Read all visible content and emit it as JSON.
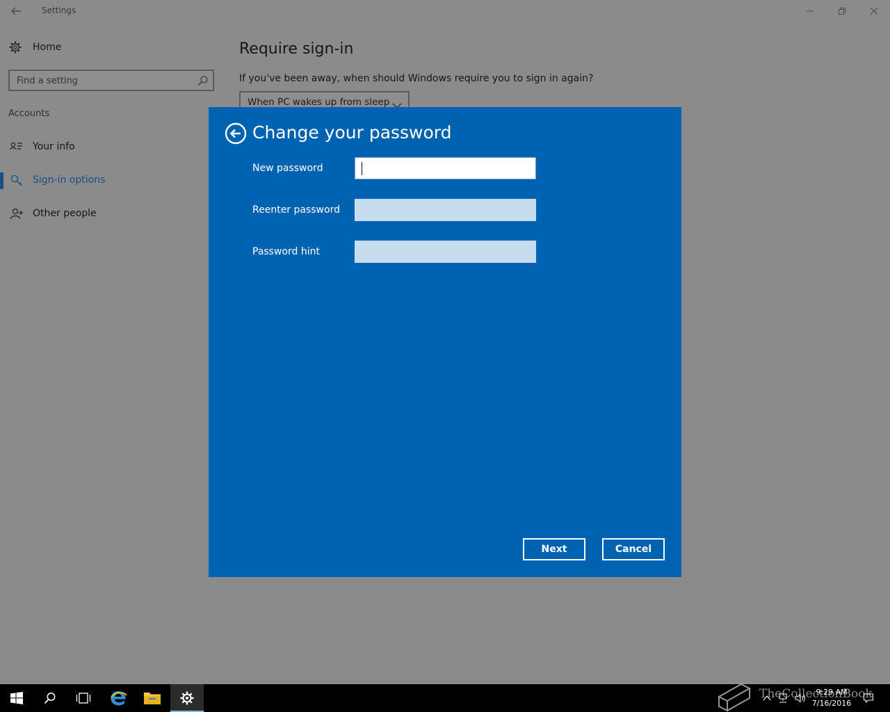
{
  "window": {
    "title": "Settings"
  },
  "sidebar": {
    "home_label": "Home",
    "search_placeholder": "Find a setting",
    "section_label": "Accounts",
    "items": [
      {
        "label": "Your info",
        "icon": "person-card-icon",
        "selected": false
      },
      {
        "label": "Sign-in options",
        "icon": "key-icon",
        "selected": true
      },
      {
        "label": "Other people",
        "icon": "person-add-icon",
        "selected": false
      }
    ]
  },
  "main": {
    "title": "Require sign-in",
    "description": "If you've been away, when should Windows require you to sign in again?",
    "dropdown_value": "When PC wakes up from sleep"
  },
  "dialog": {
    "title": "Change your password",
    "fields": [
      {
        "label": "New password",
        "value": ""
      },
      {
        "label": "Reenter password",
        "value": ""
      },
      {
        "label": "Password hint",
        "value": ""
      }
    ],
    "next_label": "Next",
    "cancel_label": "Cancel"
  },
  "taskbar": {
    "time": "9:29 AM",
    "date": "7/16/2016",
    "watermark": "TheCollectionBook"
  },
  "colors": {
    "dialog_bg": "#0063b1",
    "accent": "#1a4e84",
    "taskbar_bg": "#000000",
    "dim_bg": "#8b8b8b"
  }
}
